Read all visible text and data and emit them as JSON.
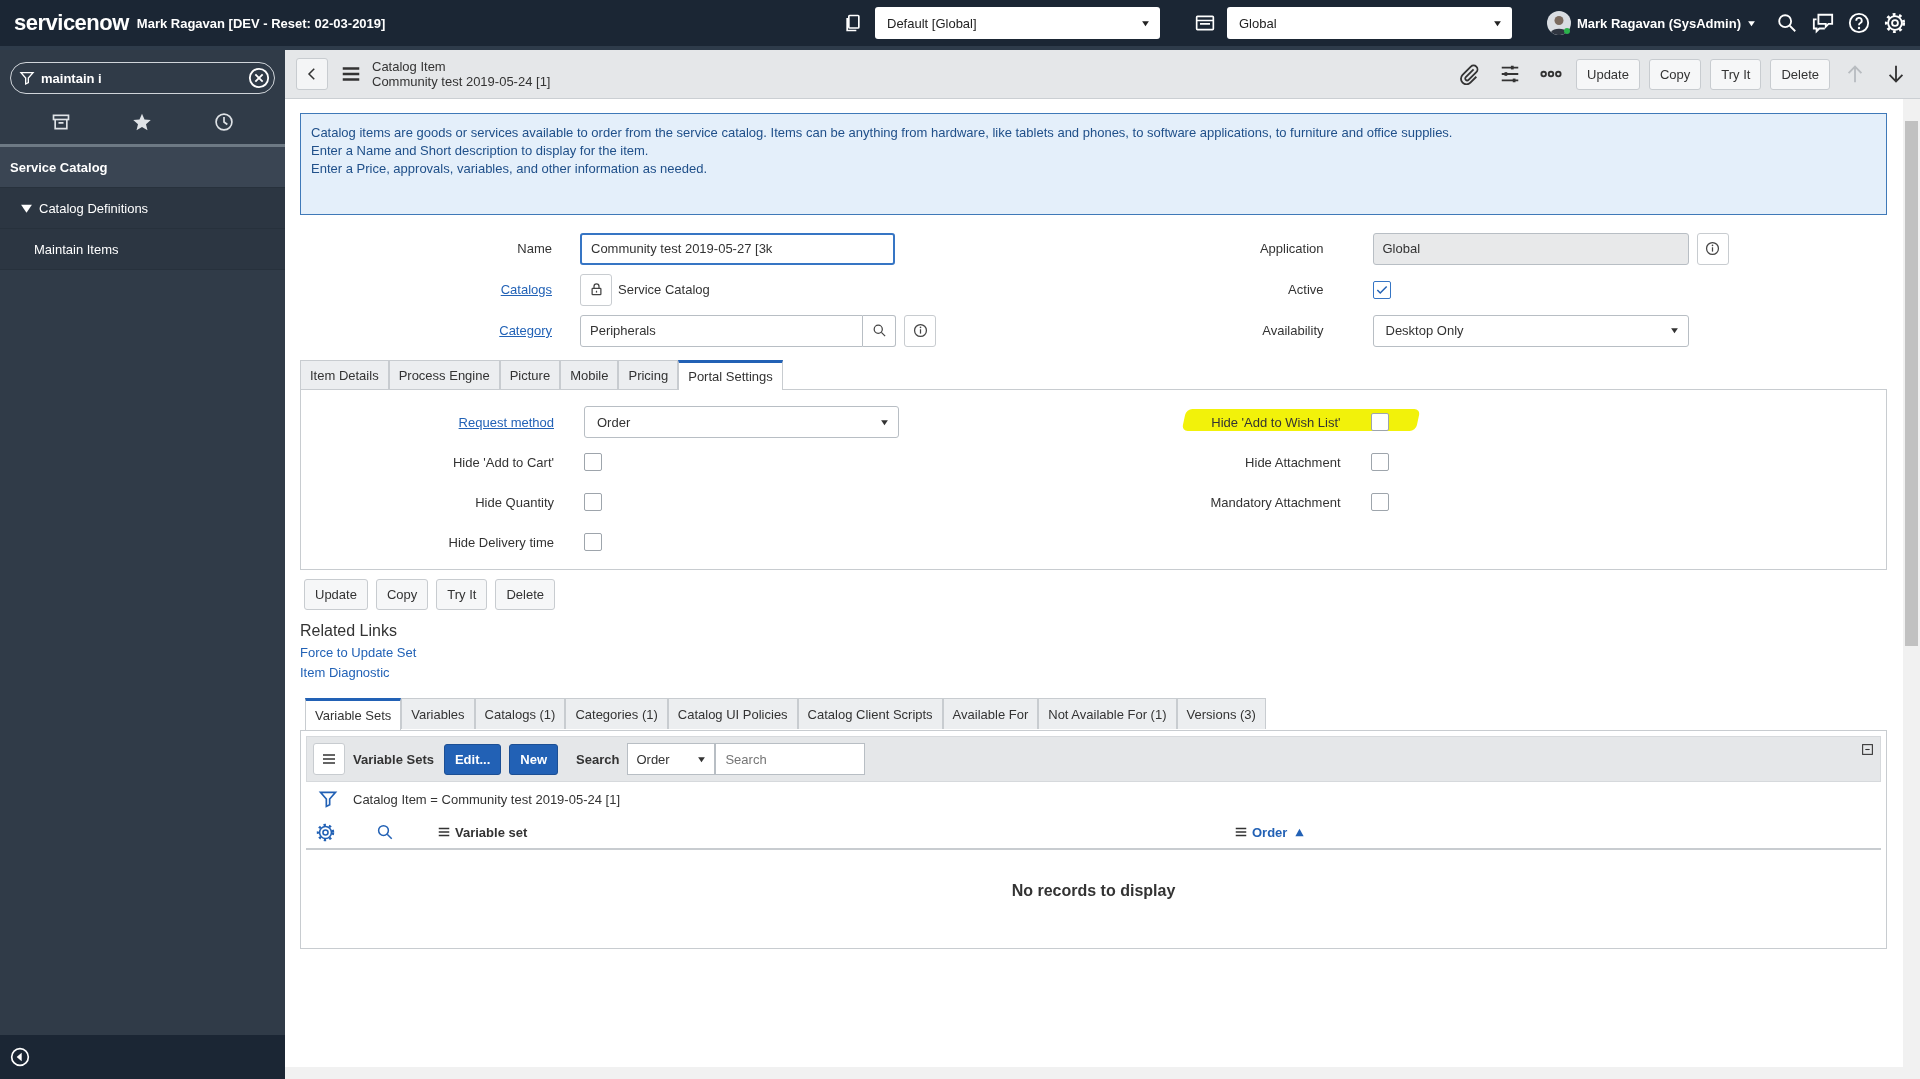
{
  "header": {
    "brand": "servicenow",
    "instance": "Mark Ragavan [DEV - Reset: 02-03-2019]",
    "update_set": "Default [Global]",
    "scope": "Global",
    "user": "Mark Ragavan (SysAdmin)"
  },
  "sidebar": {
    "filter": "maintain i",
    "section": "Service Catalog",
    "items": [
      {
        "label": "Catalog Definitions",
        "expanded": true,
        "children": [
          {
            "label": "Maintain Items"
          }
        ]
      }
    ]
  },
  "form_header": {
    "title": "Catalog Item",
    "subtitle": "Community test 2019-05-24 [1]",
    "buttons": [
      "Update",
      "Copy",
      "Try It",
      "Delete"
    ]
  },
  "info": [
    "Catalog items are goods or services available to order from the service catalog. Items can be anything from hardware, like tablets and phones, to software applications, to furniture and office supplies.",
    "Enter a Name and Short description to display for the item.",
    "Enter a Price, approvals, variables, and other information as needed."
  ],
  "fields_left": [
    {
      "kind": "text",
      "label": "Name",
      "link": false,
      "value": "Community test 2019-05-27 [3k",
      "focused": true
    },
    {
      "kind": "locked",
      "label": "Catalogs",
      "link": true,
      "value": "Service Catalog"
    },
    {
      "kind": "reference",
      "label": "Category",
      "link": true,
      "value": "Peripherals"
    }
  ],
  "fields_right": [
    {
      "kind": "readonly",
      "label": "Application",
      "link": false,
      "value": "Global"
    },
    {
      "kind": "checkbox",
      "label": "Active",
      "link": false,
      "checked": true
    },
    {
      "kind": "select",
      "label": "Availability",
      "link": false,
      "value": "Desktop Only"
    }
  ],
  "form_tabs": [
    {
      "label": "Item Details",
      "selected": false
    },
    {
      "label": "Process Engine",
      "selected": false
    },
    {
      "label": "Picture",
      "selected": false
    },
    {
      "label": "Mobile",
      "selected": false
    },
    {
      "label": "Pricing",
      "selected": false
    },
    {
      "label": "Portal Settings",
      "selected": true
    }
  ],
  "portal_settings": {
    "left": [
      {
        "kind": "select",
        "label": "Request method",
        "link": true,
        "value": "Order"
      },
      {
        "kind": "checkbox",
        "label": "Hide 'Add to Cart'",
        "link": false,
        "checked": false
      },
      {
        "kind": "checkbox",
        "label": "Hide Quantity",
        "link": false,
        "checked": false
      },
      {
        "kind": "checkbox",
        "label": "Hide Delivery time",
        "link": false,
        "checked": false
      }
    ],
    "right": [
      {
        "kind": "checkbox",
        "label": "Hide 'Add to Wish List'",
        "link": false,
        "checked": false,
        "highlighted": true
      },
      {
        "kind": "checkbox",
        "label": "Hide Attachment",
        "link": false,
        "checked": false,
        "highlighted": false
      },
      {
        "kind": "checkbox",
        "label": "Mandatory Attachment",
        "link": false,
        "checked": false,
        "highlighted": false
      }
    ]
  },
  "bottom_buttons": [
    "Update",
    "Copy",
    "Try It",
    "Delete"
  ],
  "related_links": {
    "title": "Related Links",
    "links": [
      "Force to Update Set",
      "Item Diagnostic"
    ]
  },
  "related_lists": {
    "tabs": [
      {
        "label": "Variable Sets",
        "selected": true
      },
      {
        "label": "Variables",
        "selected": false
      },
      {
        "label": "Catalogs (1)",
        "selected": false
      },
      {
        "label": "Categories (1)",
        "selected": false
      },
      {
        "label": "Catalog UI Policies",
        "selected": false
      },
      {
        "label": "Catalog Client Scripts",
        "selected": false
      },
      {
        "label": "Available For",
        "selected": false
      },
      {
        "label": "Not Available For (1)",
        "selected": false
      },
      {
        "label": "Versions (3)",
        "selected": false
      }
    ],
    "toolbar": {
      "title": "Variable Sets",
      "buttons": [
        "Edit...",
        "New"
      ],
      "search_label": "Search",
      "search_field": "Order",
      "search_placeholder": "Search"
    },
    "filter": "Catalog Item = Community test 2019-05-24 [1]",
    "columns": [
      {
        "label": "Variable set",
        "sorted": false
      },
      {
        "label": "Order",
        "sorted": true
      }
    ],
    "empty": "No records to display"
  }
}
